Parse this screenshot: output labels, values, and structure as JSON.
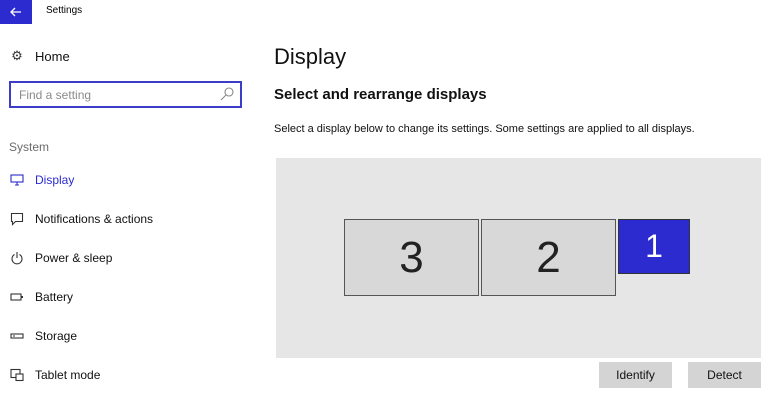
{
  "titlebar": {
    "title": "Settings",
    "back_icon": "arrow-left-icon"
  },
  "sidebar": {
    "home_label": "Home",
    "search_placeholder": "Find a setting",
    "section_label": "System",
    "items": [
      {
        "label": "Display",
        "icon": "monitor-icon",
        "active": true
      },
      {
        "label": "Notifications & actions",
        "icon": "notification-icon"
      },
      {
        "label": "Power & sleep",
        "icon": "power-icon"
      },
      {
        "label": "Battery",
        "icon": "battery-icon"
      },
      {
        "label": "Storage",
        "icon": "storage-icon"
      },
      {
        "label": "Tablet mode",
        "icon": "tablet-mode-icon"
      }
    ]
  },
  "main": {
    "page_title": "Display",
    "section_title": "Select and rearrange displays",
    "description": "Select a display below to change its settings. Some settings are applied to all displays.",
    "monitors": [
      {
        "number": "3",
        "selected": false
      },
      {
        "number": "2",
        "selected": false
      },
      {
        "number": "1",
        "selected": true
      }
    ],
    "identify_label": "Identify",
    "detect_label": "Detect"
  },
  "colors": {
    "accent": "#2b2bcf",
    "arrange_bg": "#e6e6e6",
    "monitor_bg": "#d8d8d8",
    "button_bg": "#d4d4d4"
  }
}
